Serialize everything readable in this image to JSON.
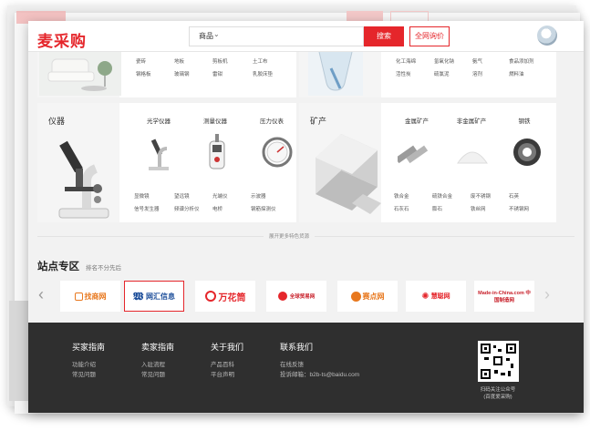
{
  "header": {
    "logo": "麦采购",
    "search_category": "商品",
    "search_button": "搜索",
    "price_button": "全网询价"
  },
  "top_left_card": {
    "links": [
      "瓷砖",
      "地板",
      "剪板机",
      "土工布",
      "钢格板",
      "玻璃钢",
      "雷钳",
      "乳胶床垫"
    ]
  },
  "top_right_card": {
    "links": [
      "化工海绵",
      "氢氧化钠",
      "氨气",
      "食品添加剂",
      "活性炭",
      "硫氯泥",
      "溶剂",
      "燃料油"
    ]
  },
  "instrument_card": {
    "title": "仪器",
    "subcategories": [
      "光学仪器",
      "测量仪器",
      "压力仪表"
    ],
    "links": [
      "显微镜",
      "望远镜",
      "光端仪",
      "示波器",
      "信号发生器",
      "频谱分析仪",
      "电桥",
      "钢筋探测仪"
    ]
  },
  "mineral_card": {
    "title": "矿产",
    "subcategories": [
      "金属矿产",
      "非金属矿产",
      "钢铁"
    ],
    "links": [
      "铁合金",
      "硫铁合金",
      "废不锈钢",
      "石英",
      "石灰石",
      "膨石",
      "铁丝网",
      "不锈钢网"
    ]
  },
  "more_text": "展开更多特色货源",
  "sites_section": {
    "title": "站点专区",
    "subtitle": "排名不分先后",
    "sites": [
      "找商网",
      "网汇信息",
      "万花筒",
      "全球贸易网",
      "赛点网",
      "慧聪网",
      "Made-in-China.com 中国制造网"
    ]
  },
  "footer": {
    "columns": [
      {
        "heading": "买家指南",
        "links": [
          "功能介绍",
          "常见问题"
        ]
      },
      {
        "heading": "卖家指南",
        "links": [
          "入驻流程",
          "常见问题"
        ]
      },
      {
        "heading": "关于我们",
        "links": [
          "产品百科",
          "平台声明"
        ]
      },
      {
        "heading": "联系我们",
        "links": [
          "在线反馈",
          "投诉邮箱：b2b-ts@baidu.com"
        ]
      }
    ],
    "qr_caption_1": "扫码关注公众号",
    "qr_caption_2": "(百度爱采购)"
  },
  "colors": {
    "brand": "#e5262b",
    "footer_bg": "#2f2f2f"
  }
}
